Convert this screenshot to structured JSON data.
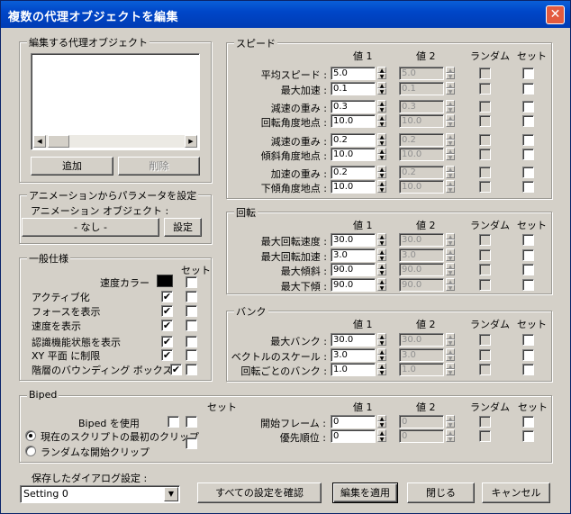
{
  "window": {
    "title": "複数の代理オブジェクトを編集",
    "close_glyph": "✕"
  },
  "proxy_group": {
    "title": "編集する代理オブジェクト",
    "add_label": "追加",
    "delete_label": "削除"
  },
  "anim_group": {
    "title": "アニメーションからパラメータを設定",
    "object_label": "アニメーション オブジェクト :",
    "object_value": "- なし -",
    "set_label": "設定"
  },
  "general": {
    "title": "一般仕様",
    "set_header": "セット",
    "speed_color_label": "速度カラー",
    "speed_color": "#000000",
    "items": [
      {
        "label": "アクティブ化",
        "checked": true
      },
      {
        "label": "フォースを表示",
        "checked": true
      },
      {
        "label": "速度を表示",
        "checked": true
      },
      {
        "label": "認識機能状態を表示",
        "checked": true
      },
      {
        "label": "XY 平面 に制限",
        "checked": true
      },
      {
        "label": "階層のバウンディング ボックス",
        "checked": true
      }
    ]
  },
  "headers": {
    "v1": "値 1",
    "v2": "値 2",
    "random": "ランダム",
    "set": "セット"
  },
  "speed": {
    "title": "スピード",
    "rows": [
      {
        "label": "平均スピード :",
        "v1": "5.0",
        "v2": "5.0"
      },
      {
        "label": "最大加速 :",
        "v1": "0.1",
        "v2": "0.1"
      },
      {
        "label": "減速の重み :",
        "v1": "0.3",
        "v2": "0.3"
      },
      {
        "label": "回転角度地点 :",
        "v1": "10.0",
        "v2": "10.0"
      },
      {
        "label": "減速の重み :",
        "v1": "0.2",
        "v2": "0.2"
      },
      {
        "label": "傾斜角度地点 :",
        "v1": "10.0",
        "v2": "10.0"
      },
      {
        "label": "加速の重み :",
        "v1": "0.2",
        "v2": "0.2"
      },
      {
        "label": "下傾角度地点 :",
        "v1": "10.0",
        "v2": "10.0"
      }
    ]
  },
  "rotation": {
    "title": "回転",
    "rows": [
      {
        "label": "最大回転速度 :",
        "v1": "30.0",
        "v2": "30.0"
      },
      {
        "label": "最大回転加速 :",
        "v1": "3.0",
        "v2": "3.0"
      },
      {
        "label": "最大傾斜 :",
        "v1": "90.0",
        "v2": "90.0"
      },
      {
        "label": "最大下傾 :",
        "v1": "90.0",
        "v2": "90.0"
      }
    ]
  },
  "bank": {
    "title": "バンク",
    "rows": [
      {
        "label": "最大バンク :",
        "v1": "30.0",
        "v2": "30.0"
      },
      {
        "label": "ベクトルのスケール :",
        "v1": "3.0",
        "v2": "3.0"
      },
      {
        "label": "回転ごとのバンク :",
        "v1": "1.0",
        "v2": "1.0"
      }
    ]
  },
  "biped": {
    "title": "Biped",
    "set_header": "セット",
    "use_label": "Biped を使用",
    "radio1_label": "現在のスクリプトの最初のクリップ",
    "radio2_label": "ランダムな開始クリップ",
    "rows": [
      {
        "label": "開始フレーム :",
        "v1": "0",
        "v2": "0"
      },
      {
        "label": "優先順位 :",
        "v1": "0",
        "v2": "0"
      }
    ]
  },
  "footer": {
    "saved_label": "保存したダイアログ設定 :",
    "saved_value": "Setting 0",
    "confirm_label": "すべての設定を確認",
    "apply_label": "編集を適用",
    "close_label": "閉じる",
    "cancel_label": "キャンセル"
  },
  "icons": {
    "spin_up": "▲",
    "spin_down": "▼",
    "scroll_left": "◀",
    "scroll_right": "▶",
    "combo_down": "▼",
    "check": "✔"
  }
}
